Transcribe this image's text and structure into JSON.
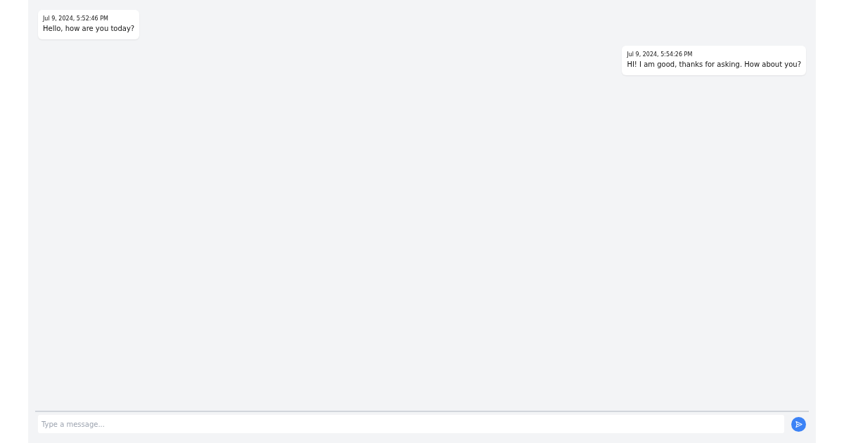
{
  "messages": [
    {
      "kind": "received",
      "time": "Jul 9, 2024, 5:52:46 PM",
      "text": "Hello, how are you today?"
    },
    {
      "kind": "sent",
      "time": "Jul 9, 2024, 5:54:26 PM",
      "text": "HI! I am good, thanks for asking. How about you?"
    }
  ],
  "composer": {
    "placeholder": "Type a message..."
  }
}
